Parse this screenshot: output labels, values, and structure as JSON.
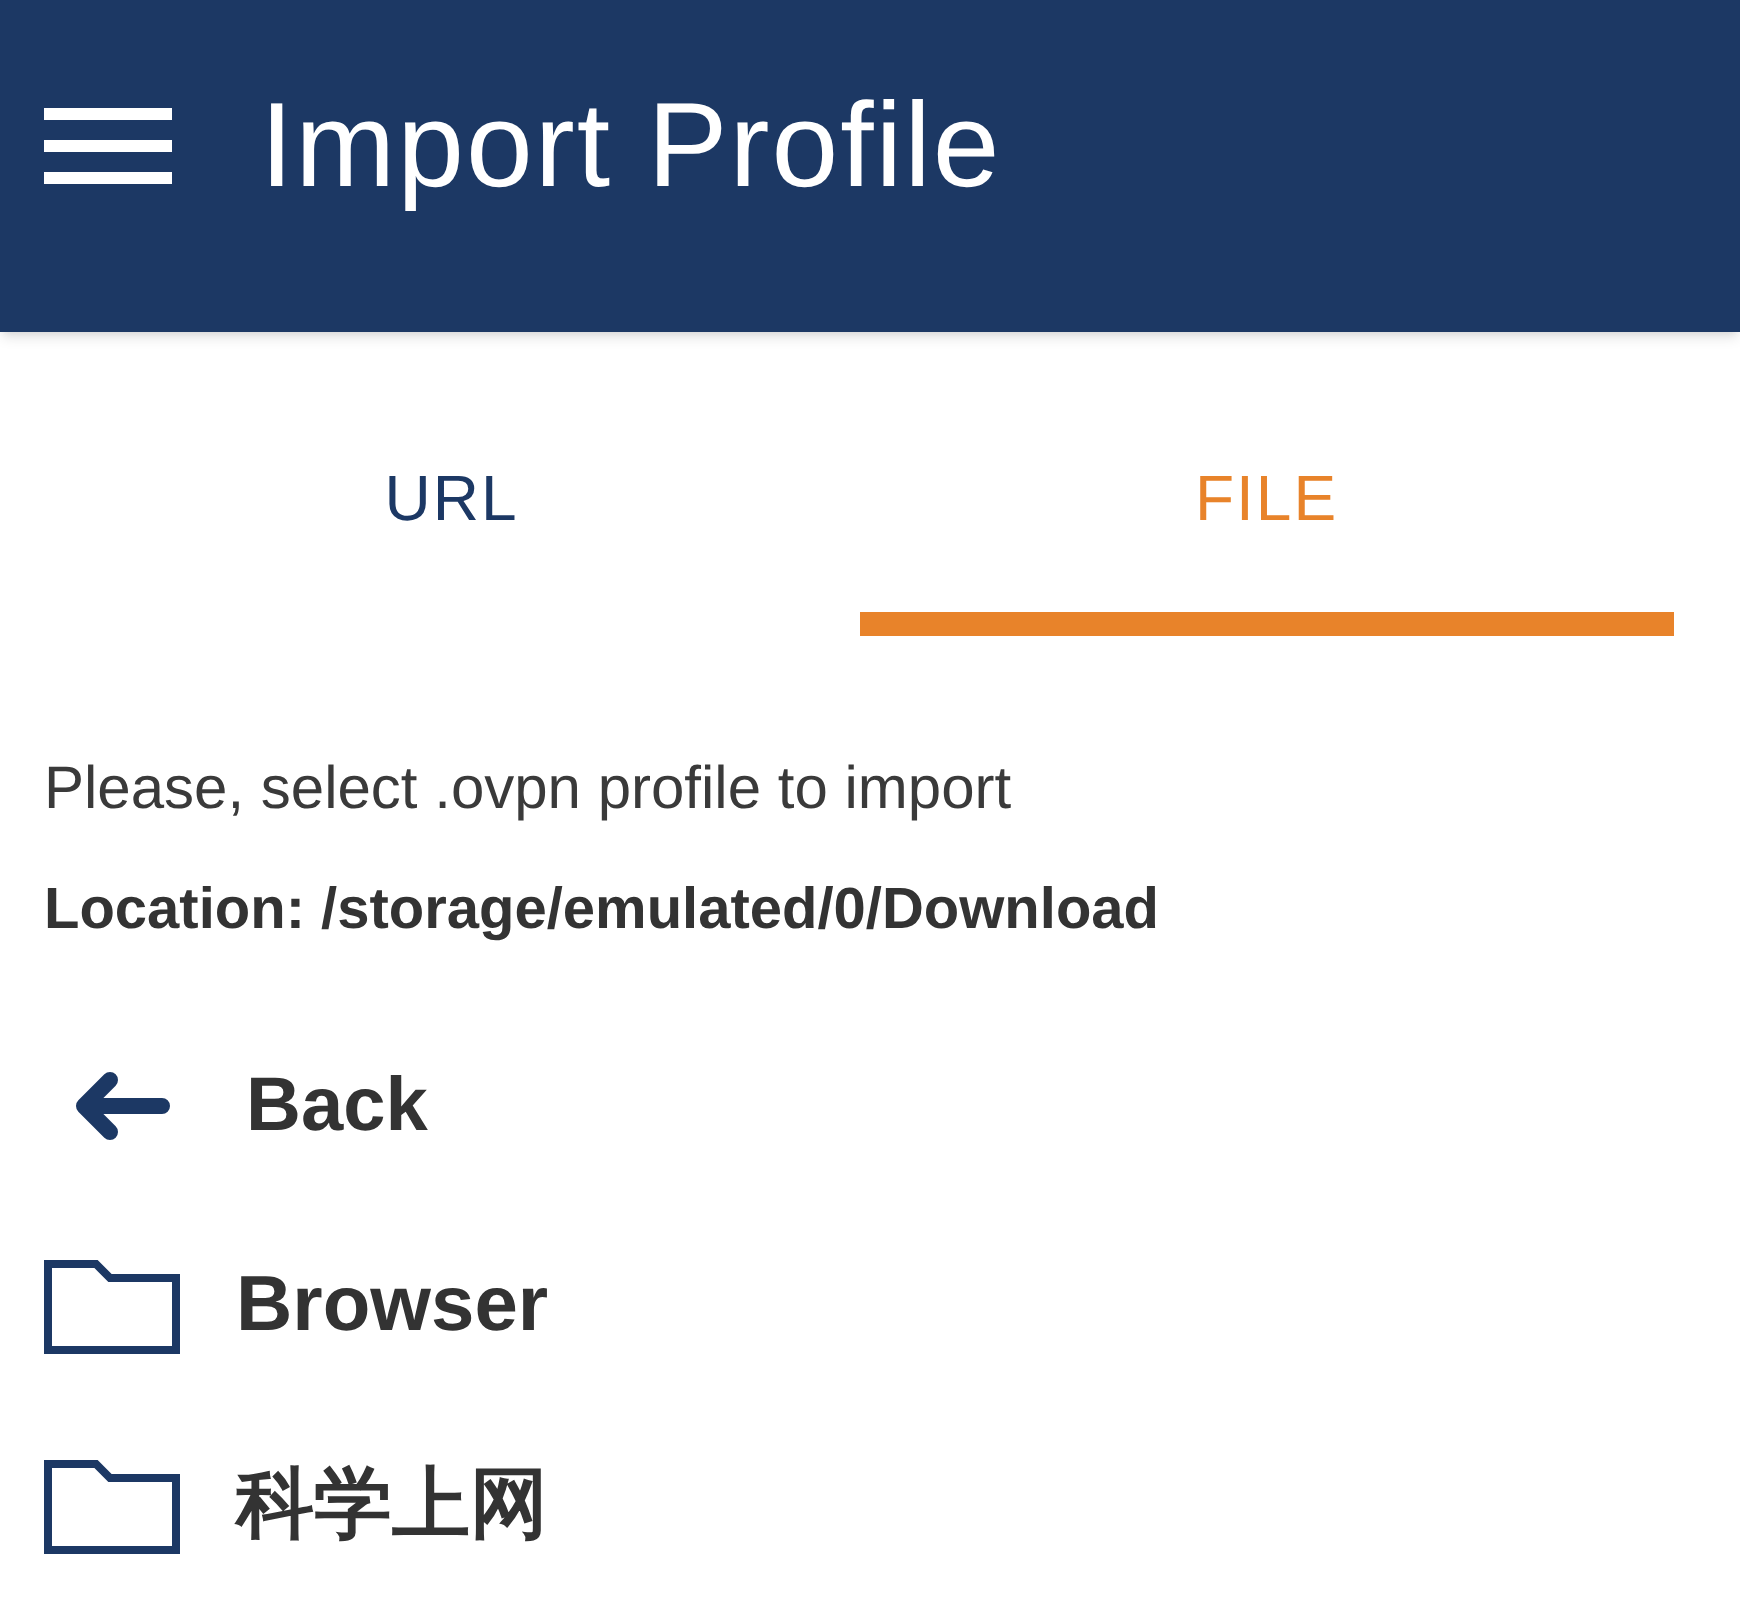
{
  "app_bar": {
    "title": "Import Profile"
  },
  "tabs": [
    {
      "label": "URL",
      "selected": false
    },
    {
      "label": "FILE",
      "selected": true
    }
  ],
  "instruction": "Please, select .ovpn profile to import",
  "location": "Location: /storage/emulated/0/Download",
  "entries": [
    {
      "kind": "back",
      "name": "Back"
    },
    {
      "kind": "folder",
      "name": "Browser"
    },
    {
      "kind": "folder",
      "name": "科学上网"
    }
  ]
}
